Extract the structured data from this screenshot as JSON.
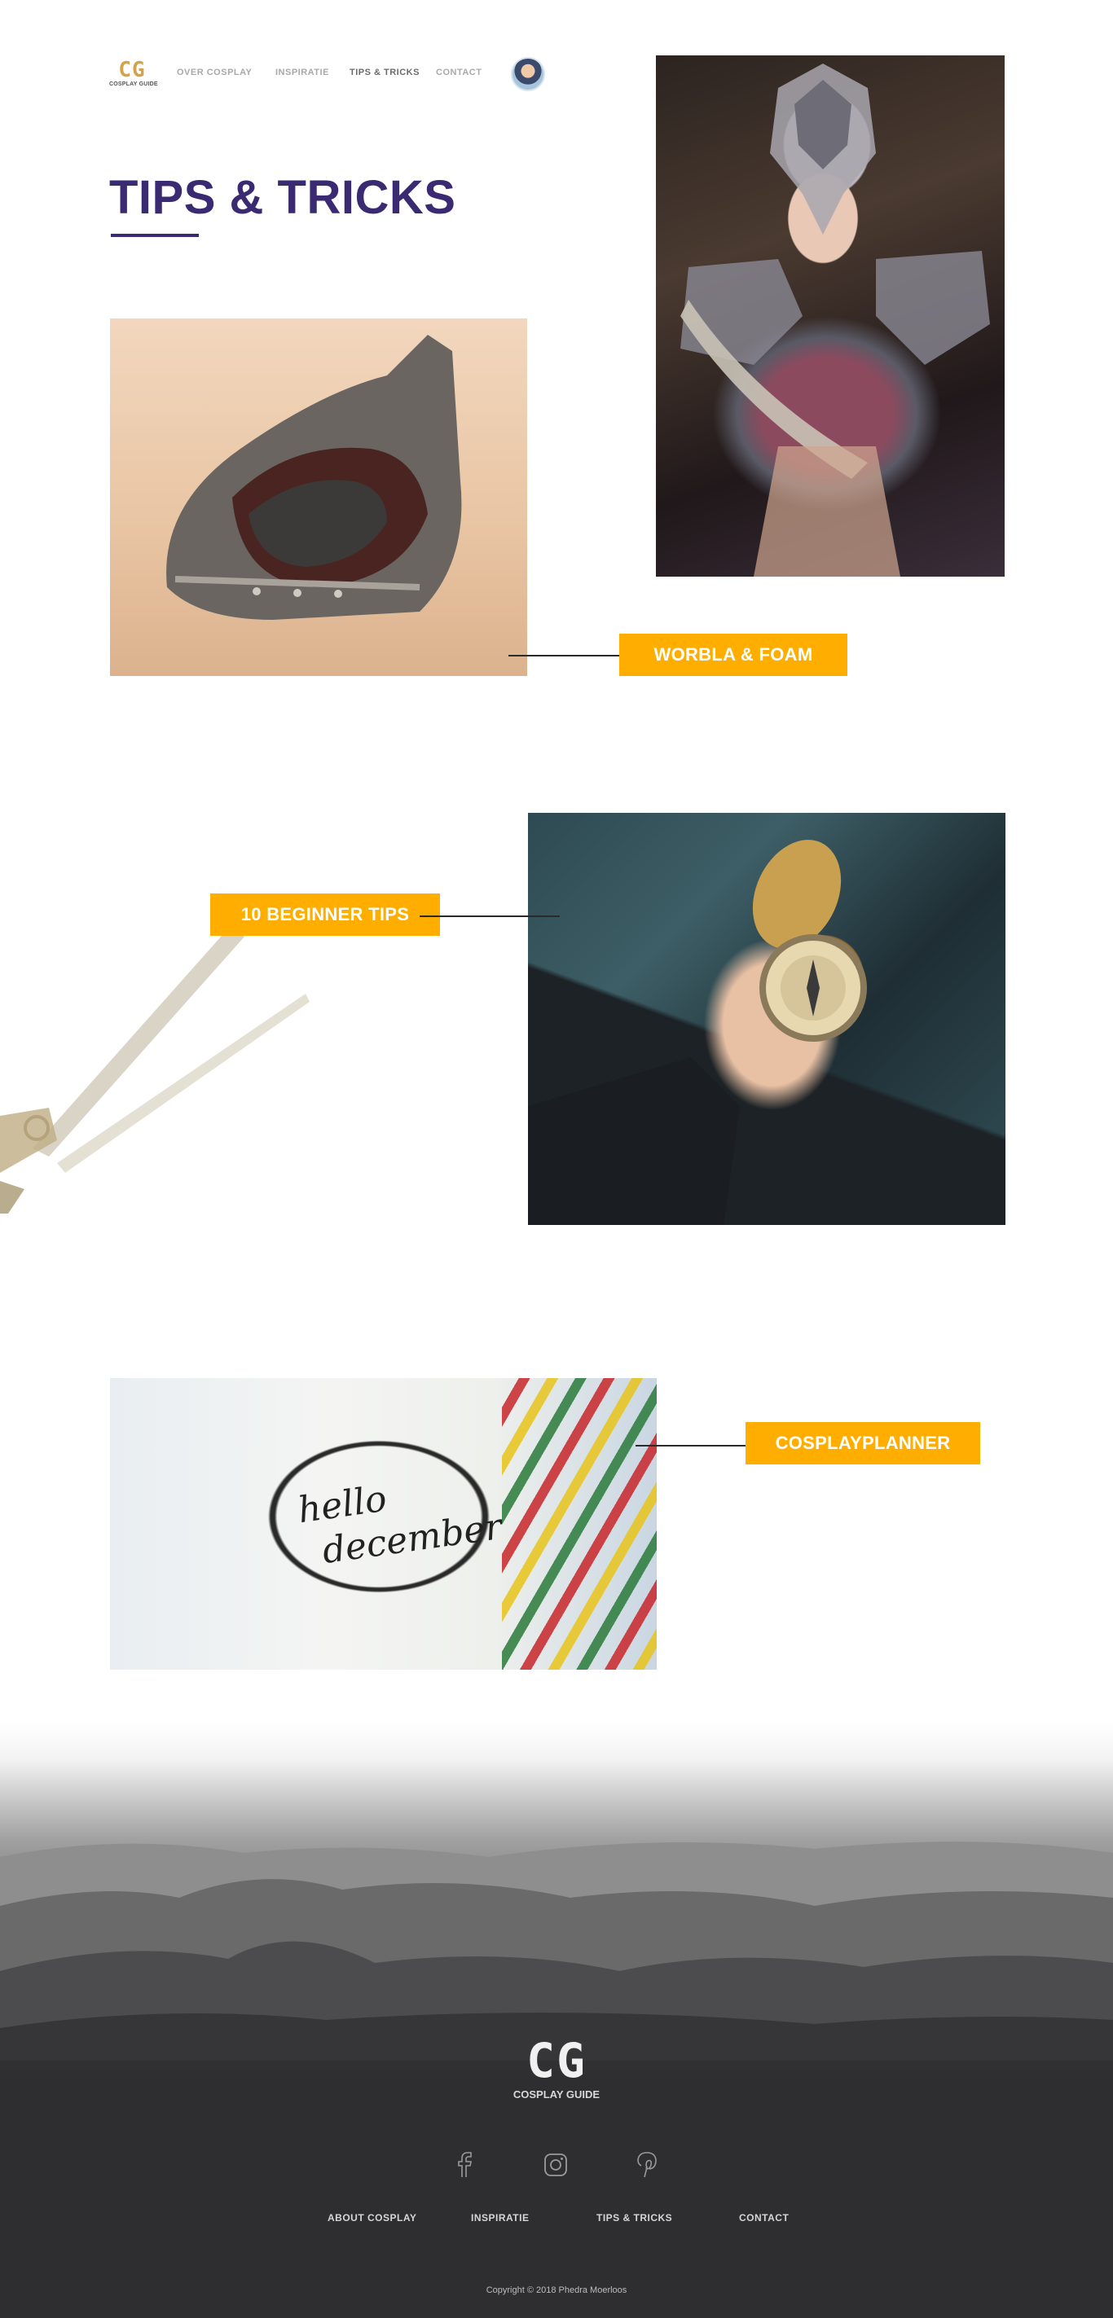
{
  "header": {
    "logo_mark": "CG",
    "logo_text": "COSPLAY GUIDE",
    "nav": [
      "OVER COSPLAY",
      "INSPIRATIE",
      "TIPS & TRICKS",
      "CONTACT"
    ],
    "active_nav": "TIPS & TRICKS"
  },
  "main": {
    "title": "TIPS & TRICKS",
    "articles": [
      {
        "label": "WORBLA & FOAM"
      },
      {
        "label": "10 BEGINNER TIPS"
      },
      {
        "label": "COSPLAYPLANNER"
      }
    ],
    "journal_script": [
      "hello",
      "december"
    ]
  },
  "footer": {
    "logo_mark": "CG",
    "logo_text": "COSPLAY GUIDE",
    "social": [
      "facebook-icon",
      "instagram-icon",
      "pinterest-icon"
    ],
    "nav": [
      "ABOUT COSPLAY",
      "INSPIRATIE",
      "TIPS & TRICKS",
      "CONTACT"
    ],
    "copyright": "Copyright © 2018 Phedra Moerloos"
  },
  "colors": {
    "accent": "#ffae00",
    "title": "#3a2a72",
    "logo": "#d4a24a",
    "footer_bg": "#2e2e30"
  }
}
